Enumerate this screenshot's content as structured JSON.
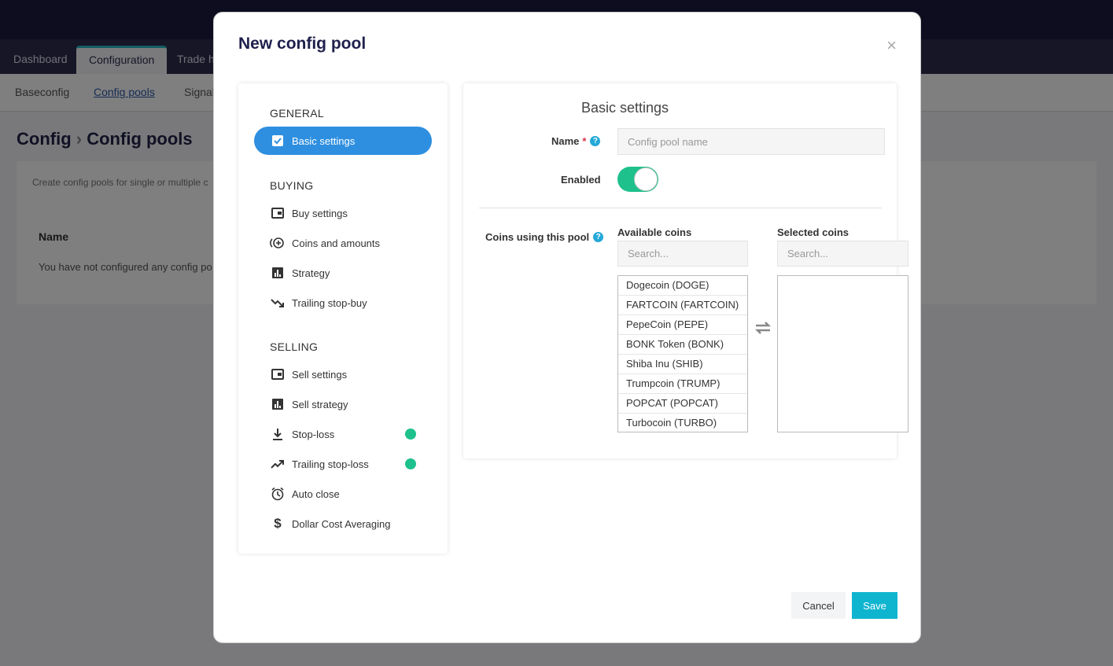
{
  "background": {
    "tabs": [
      "Dashboard",
      "Configuration",
      "Trade hi"
    ],
    "subnav": [
      "Baseconfig",
      "Config pools",
      "Signal"
    ],
    "breadcrumb": {
      "root": "Config",
      "separator": "›",
      "current": "Config pools"
    },
    "description": "Create config pools for single or multiple c",
    "column_name": "Name",
    "empty_text": "You have not configured any config po"
  },
  "modal": {
    "title": "New config pool",
    "close": "×",
    "nav": {
      "sections": [
        {
          "label": "GENERAL",
          "items": [
            {
              "label": "Basic settings",
              "icon": "checkbox-icon",
              "active": true
            }
          ]
        },
        {
          "label": "BUYING",
          "items": [
            {
              "label": "Buy settings",
              "icon": "wallet-icon"
            },
            {
              "label": "Coins and amounts",
              "icon": "coin-plus-icon"
            },
            {
              "label": "Strategy",
              "icon": "bar-chart-icon"
            },
            {
              "label": "Trailing stop-buy",
              "icon": "trending-down-icon"
            }
          ]
        },
        {
          "label": "SELLING",
          "items": [
            {
              "label": "Sell settings",
              "icon": "wallet-icon"
            },
            {
              "label": "Sell strategy",
              "icon": "bar-chart-icon"
            },
            {
              "label": "Stop-loss",
              "icon": "download-icon",
              "status_dot": true
            },
            {
              "label": "Trailing stop-loss",
              "icon": "trending-up-icon",
              "status_dot": true
            },
            {
              "label": "Auto close",
              "icon": "alarm-icon"
            },
            {
              "label": "Dollar Cost Averaging",
              "icon": "dollar-icon"
            }
          ]
        }
      ]
    },
    "panel": {
      "title": "Basic settings",
      "name_label": "Name",
      "name_required": "*",
      "name_placeholder": "Config pool name",
      "enabled_label": "Enabled",
      "enabled": true,
      "coins_label": "Coins using this pool",
      "available_label": "Available coins",
      "selected_label": "Selected coins",
      "search_placeholder": "Search...",
      "available_coins": [
        "Dogecoin (DOGE)",
        "FARTCOIN (FARTCOIN)",
        "PepeCoin (PEPE)",
        "BONK Token (BONK)",
        "Shiba Inu (SHIB)",
        "Trumpcoin (TRUMP)",
        "POPCAT (POPCAT)",
        "Turbocoin (TURBO)"
      ],
      "selected_coins": []
    },
    "buttons": {
      "cancel": "Cancel",
      "save": "Save"
    }
  },
  "colors": {
    "accent": "#2e8fe0",
    "toggle_on": "#1ec08c",
    "save": "#0fb4cf",
    "status_dot": "#1ec08c"
  }
}
